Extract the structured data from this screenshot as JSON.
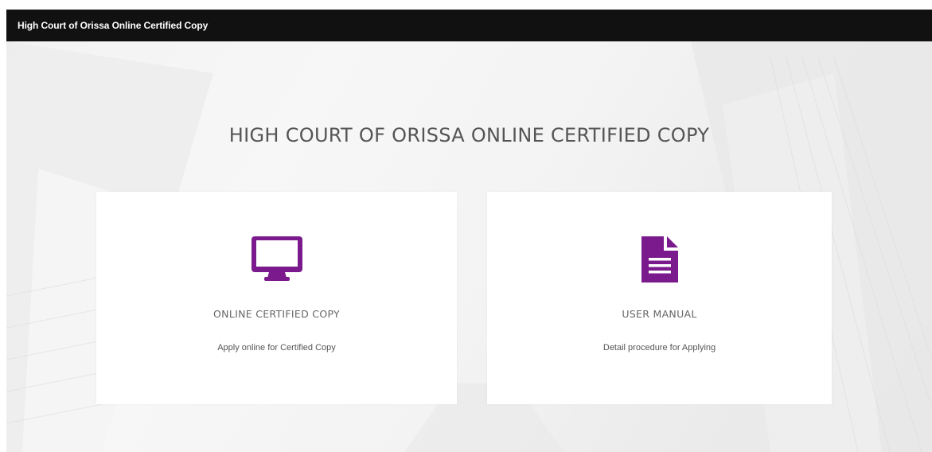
{
  "header": {
    "brand": "High Court of Orissa Online Certified Copy"
  },
  "main": {
    "heading": "HIGH COURT OF ORISSA ONLINE CERTIFIED COPY",
    "cards": [
      {
        "icon": "monitor-icon",
        "title": "ONLINE CERTIFIED COPY",
        "description": "Apply online for Certified Copy"
      },
      {
        "icon": "document-icon",
        "title": "USER MANUAL",
        "description": "Detail procedure for Applying"
      }
    ]
  },
  "colors": {
    "topbar": "#111111",
    "accent": "#7b1a8c",
    "card_background": "#ffffff",
    "page_background": "#f2f2f2"
  }
}
